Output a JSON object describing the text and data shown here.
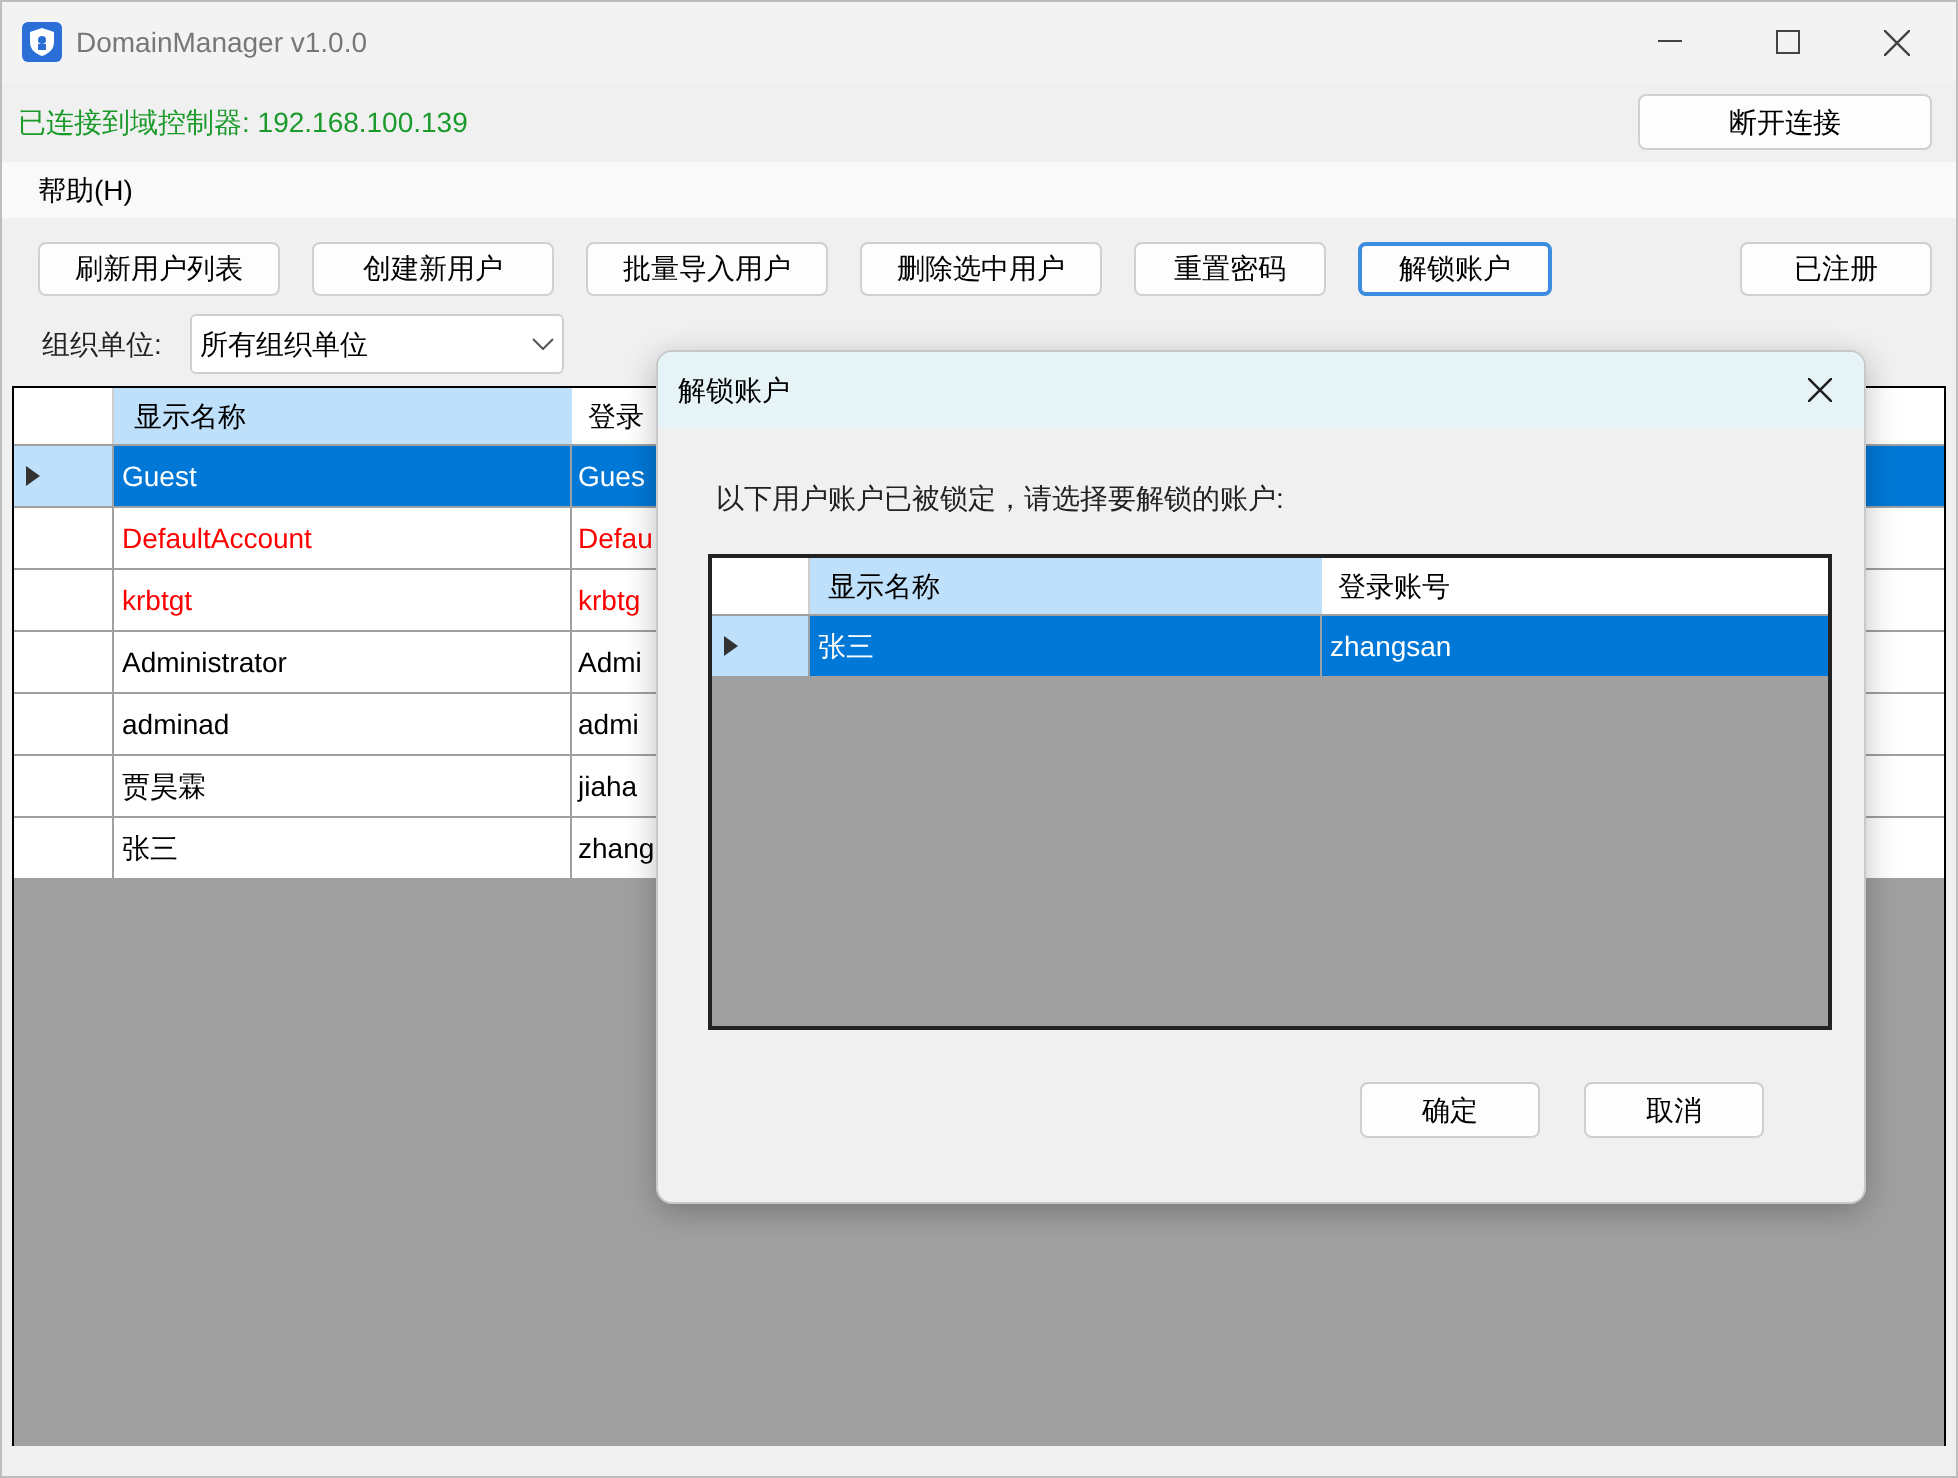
{
  "window": {
    "title": "DomainManager v1.0.0"
  },
  "connection": {
    "status": "已连接到域控制器: 192.168.100.139",
    "disconnect_button": "断开连接"
  },
  "menu": [
    "帮助(H)"
  ],
  "toolbar": [
    {
      "label": "刷新用户列表",
      "focused": false
    },
    {
      "label": "创建新用户",
      "focused": false
    },
    {
      "label": "批量导入用户",
      "focused": false
    },
    {
      "label": "删除选中用户",
      "focused": false
    },
    {
      "label": "重置密码",
      "focused": false
    },
    {
      "label": "解锁账户",
      "focused": true
    }
  ],
  "registered_button": "已注册",
  "filter": {
    "label": "组织单位:",
    "value": "所有组织单位"
  },
  "users_table": {
    "columns": [
      "显示名称",
      "登录"
    ],
    "rows": [
      {
        "cells": [
          "Guest",
          "Gues"
        ],
        "selected": true
      },
      {
        "cells": [
          "DefaultAccount",
          "Defau"
        ],
        "selected": false,
        "disabled": true
      },
      {
        "cells": [
          "krbtgt",
          "krbtg"
        ],
        "selected": false,
        "disabled": true
      },
      {
        "cells": [
          "Administrator",
          "Admi"
        ],
        "selected": false,
        "disabled": false
      },
      {
        "cells": [
          "adminad",
          "admi"
        ],
        "selected": false,
        "disabled": false
      },
      {
        "cells": [
          "贾昊霖",
          "jiaha"
        ],
        "selected": false,
        "disabled": false
      },
      {
        "cells": [
          "张三",
          "zhang"
        ],
        "selected": false,
        "disabled": false
      }
    ]
  },
  "dialog": {
    "title": "解锁账户",
    "message": "以下用户账户已被锁定，请选择要解锁的账户:",
    "table": {
      "columns": [
        "显示名称",
        "登录账号"
      ],
      "rows": [
        {
          "cells": [
            "张三",
            "zhangsan"
          ],
          "selected": true
        }
      ]
    },
    "buttons": [
      "确定",
      "取消"
    ]
  }
}
